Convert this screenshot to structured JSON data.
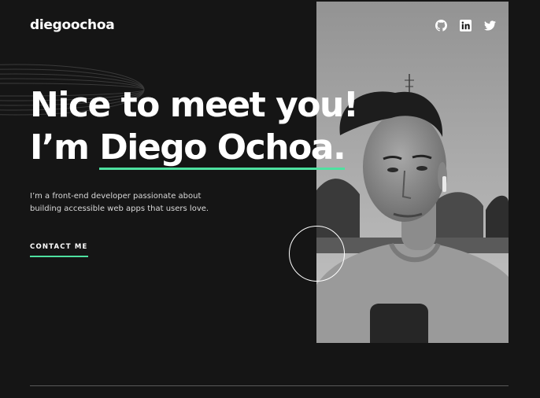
{
  "header": {
    "logo": "diegoochoa",
    "socials": [
      {
        "icon": "github-icon"
      },
      {
        "icon": "linkedin-icon"
      },
      {
        "icon": "twitter-icon"
      }
    ]
  },
  "hero": {
    "greeting": "Nice to meet you!",
    "im": "I’m",
    "name": "Diego Ochoa.",
    "intro": "I’m a front-end developer passionate about building accessible web apps that users love.",
    "cta": "CONTACT ME"
  },
  "colors": {
    "background": "#151515",
    "accent": "#4ee1a0",
    "text": "#ffffff"
  }
}
